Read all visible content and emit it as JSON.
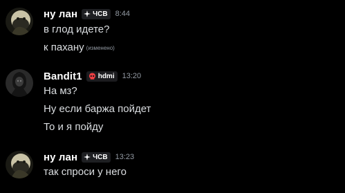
{
  "messages": [
    {
      "author": "ну лан",
      "tag": "ЧСВ",
      "tag_icon": "sparkle-icon",
      "time": "8:44",
      "lines": [
        {
          "text": "в глод идете?"
        },
        {
          "text": "к пахану",
          "edited": "(изменено)"
        }
      ],
      "avatar": "masked-character-avatar"
    },
    {
      "author": "Bandit1",
      "tag": "hdmi",
      "tag_icon": "skull-icon",
      "time": "13:20",
      "lines": [
        {
          "text": "На мз?"
        },
        {
          "text": "Ну если баржа пойдет"
        },
        {
          "text": "То и я пойду"
        }
      ],
      "avatar": "hooded-figure-avatar"
    },
    {
      "author": "ну лан",
      "tag": "ЧСВ",
      "tag_icon": "sparkle-icon",
      "time": "13:23",
      "lines": [
        {
          "text": "так спроси у него"
        }
      ],
      "avatar": "masked-character-avatar"
    }
  ],
  "colors": {
    "background": "#000000",
    "username": "#ffffff",
    "text": "#dbdee1",
    "muted": "#949ba4",
    "skull_red": "#f23f43"
  }
}
